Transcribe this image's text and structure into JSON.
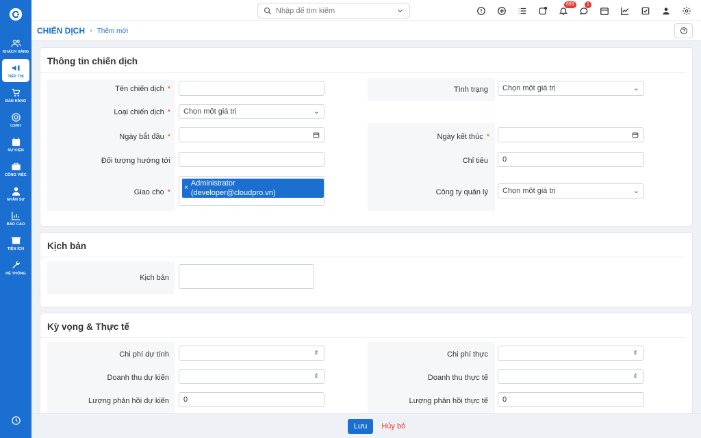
{
  "sidebar": {
    "items": [
      {
        "label": "Khách hàng",
        "icon": "users-icon"
      },
      {
        "label": "Tiếp thị",
        "icon": "megaphone-icon"
      },
      {
        "label": "Bán hàng",
        "icon": "cart-icon"
      },
      {
        "label": "CSKH",
        "icon": "support-icon"
      },
      {
        "label": "Sự kiện",
        "icon": "calendar-icon"
      },
      {
        "label": "Công việc",
        "icon": "briefcase-icon"
      },
      {
        "label": "Nhân sự",
        "icon": "person-icon"
      },
      {
        "label": "Báo cáo",
        "icon": "report-icon"
      },
      {
        "label": "Tiện ích",
        "icon": "box-icon"
      },
      {
        "label": "Hệ thống",
        "icon": "wrench-icon"
      }
    ]
  },
  "topbar": {
    "search_placeholder": "Nhập để tìm kiếm",
    "notifications_count": "693",
    "messages_count": "1"
  },
  "breadcrumb": {
    "main": "CHIẾN DỊCH",
    "sub": "Thêm mới"
  },
  "section1": {
    "title": "Thông tin chiến dịch",
    "ten_chien_dich": "Tên chiến dịch",
    "loai_chien_dich": "Loại chiến dịch",
    "ngay_bat_dau": "Ngày bắt đầu",
    "doi_tuong": "Đối tượng hướng tới",
    "giao_cho": "Giao cho",
    "tinh_trang": "Tình trạng",
    "ngay_ket_thuc": "Ngày kết thúc",
    "chi_tieu": "Chỉ tiêu",
    "chi_tieu_value": "0",
    "cong_ty": "Công ty quản lý",
    "select_placeholder": "Chọn một giá trị",
    "assignee_tag": "Administrator (developer@cloudpro.vn)"
  },
  "section2": {
    "title": "Kịch bản",
    "kich_ban": "Kịch bản"
  },
  "section3": {
    "title": "Kỳ vọng & Thực tế",
    "chi_phi_du_tinh": "Chi phí dự tính",
    "doanh_thu_du_kien": "Doanh thu dự kiến",
    "luong_phan_hoi_du_kien": "Lượng phản hồi dự kiến",
    "chi_phi_thuc": "Chi phí thực",
    "doanh_thu_thuc_te": "Doanh thu thực tế",
    "luong_phan_hoi_thuc_te": "Lượng phản hồi thực tế",
    "currency": "₫",
    "zero": "0"
  },
  "footer": {
    "save": "Lưu",
    "cancel": "Hủy bỏ"
  }
}
